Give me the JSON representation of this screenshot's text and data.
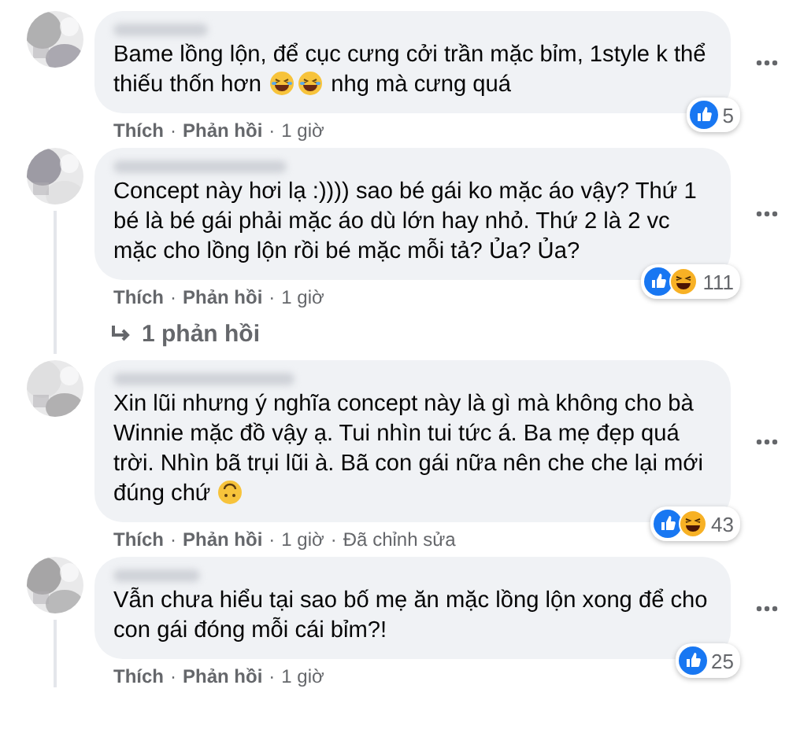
{
  "comments": [
    {
      "avatar": {
        "kind": "picture"
      },
      "body": [
        {
          "kind": "text",
          "text": "Bame lồng lộn, để cục cưng cởi trần mặc bỉm, 1style k thể thiếu thốn hơn "
        },
        {
          "kind": "laugh-emoji"
        },
        {
          "kind": "laugh-emoji"
        },
        {
          "kind": "text",
          "text": " nhg mà cưng quá"
        }
      ],
      "reactions": [
        {
          "kind": "like"
        }
      ],
      "reaction_count": "5",
      "actions": [
        {
          "kind": "link",
          "text": "Thích"
        },
        {
          "kind": "link",
          "text": "Phản hồi"
        },
        {
          "kind": "meta",
          "text": "1 giờ"
        }
      ],
      "separator": "·",
      "thread": false
    },
    {
      "avatar": {
        "kind": "picture"
      },
      "body": [
        {
          "kind": "text",
          "text": "Concept này hơi lạ :)))) sao bé gái ko mặc áo vậy? Thứ 1 bé là bé gái phải mặc áo dù lớn hay nhỏ. Thứ 2 là 2 vc mặc cho lồng lộn rồi bé mặc mỗi tả? Ủa? Ủa?"
        }
      ],
      "reactions": [
        {
          "kind": "like"
        },
        {
          "kind": "haha"
        }
      ],
      "reaction_count": "111",
      "actions": [
        {
          "kind": "link",
          "text": "Thích"
        },
        {
          "kind": "link",
          "text": "Phản hồi"
        },
        {
          "kind": "meta",
          "text": "1 giờ"
        }
      ],
      "separator": "·",
      "thread": true,
      "replies_link": "1 phản hồi"
    },
    {
      "avatar": {
        "kind": "picture"
      },
      "body": [
        {
          "kind": "text",
          "text": "Xin lũi nhưng ý nghĩa concept này là gì mà không cho bà Winnie mặc đồ vậy ạ. Tui nhìn tui tức á. Ba mẹ đẹp quá trời. Nhìn bã trụi lũi à. Bã con gái nữa nên che che lại mới đúng chứ "
        },
        {
          "kind": "upside-emoji"
        }
      ],
      "reactions": [
        {
          "kind": "like"
        },
        {
          "kind": "haha"
        }
      ],
      "reaction_count": "43",
      "actions": [
        {
          "kind": "link",
          "text": "Thích"
        },
        {
          "kind": "link",
          "text": "Phản hồi"
        },
        {
          "kind": "meta",
          "text": "1 giờ"
        },
        {
          "kind": "meta",
          "text": "Đã chỉnh sửa"
        }
      ],
      "separator": "·",
      "thread": false
    },
    {
      "avatar": {
        "kind": "picture"
      },
      "body": [
        {
          "kind": "text",
          "text": "Vẫn chưa hiểu tại sao bố mẹ ăn mặc lồng lộn xong để cho con gái đóng mỗi cái bỉm?!"
        }
      ],
      "reactions": [
        {
          "kind": "like"
        }
      ],
      "reaction_count": "25",
      "actions": [
        {
          "kind": "link",
          "text": "Thích"
        },
        {
          "kind": "link",
          "text": "Phản hồi"
        },
        {
          "kind": "meta",
          "text": "1 giờ"
        }
      ],
      "separator": "·",
      "thread": true
    }
  ]
}
